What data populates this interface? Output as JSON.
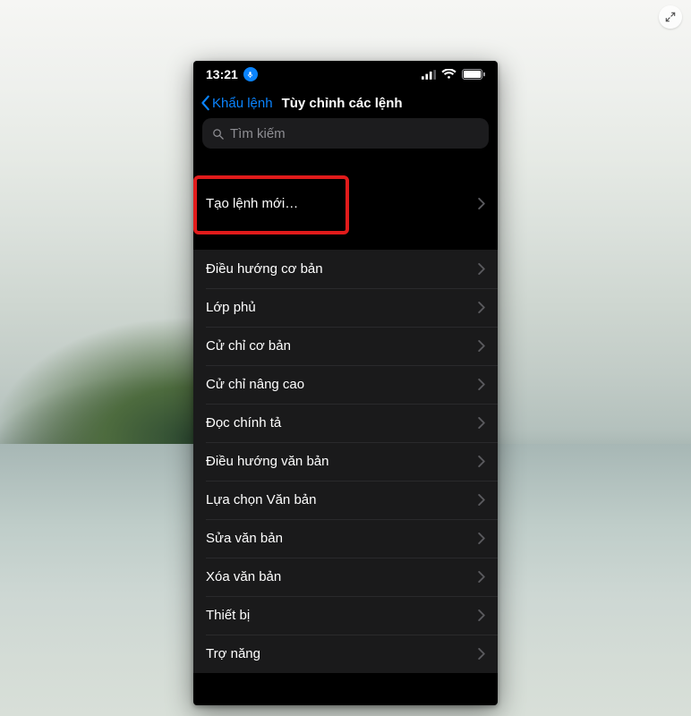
{
  "statusBar": {
    "time": "13:21"
  },
  "nav": {
    "back_label": "Khẩu lệnh",
    "title": "Tùy chỉnh các lệnh"
  },
  "search": {
    "placeholder": "Tìm kiếm"
  },
  "rows": {
    "create": "Tạo lệnh mới…",
    "r0": "Điều hướng cơ bản",
    "r1": "Lớp phủ",
    "r2": "Cử chỉ cơ bản",
    "r3": "Cử chỉ nâng cao",
    "r4": "Đọc chính tả",
    "r5": "Điều hướng văn bản",
    "r6": "Lựa chọn Văn bản",
    "r7": "Sửa văn bản",
    "r8": "Xóa văn bản",
    "r9": "Thiết bị",
    "r10": "Trợ năng"
  }
}
